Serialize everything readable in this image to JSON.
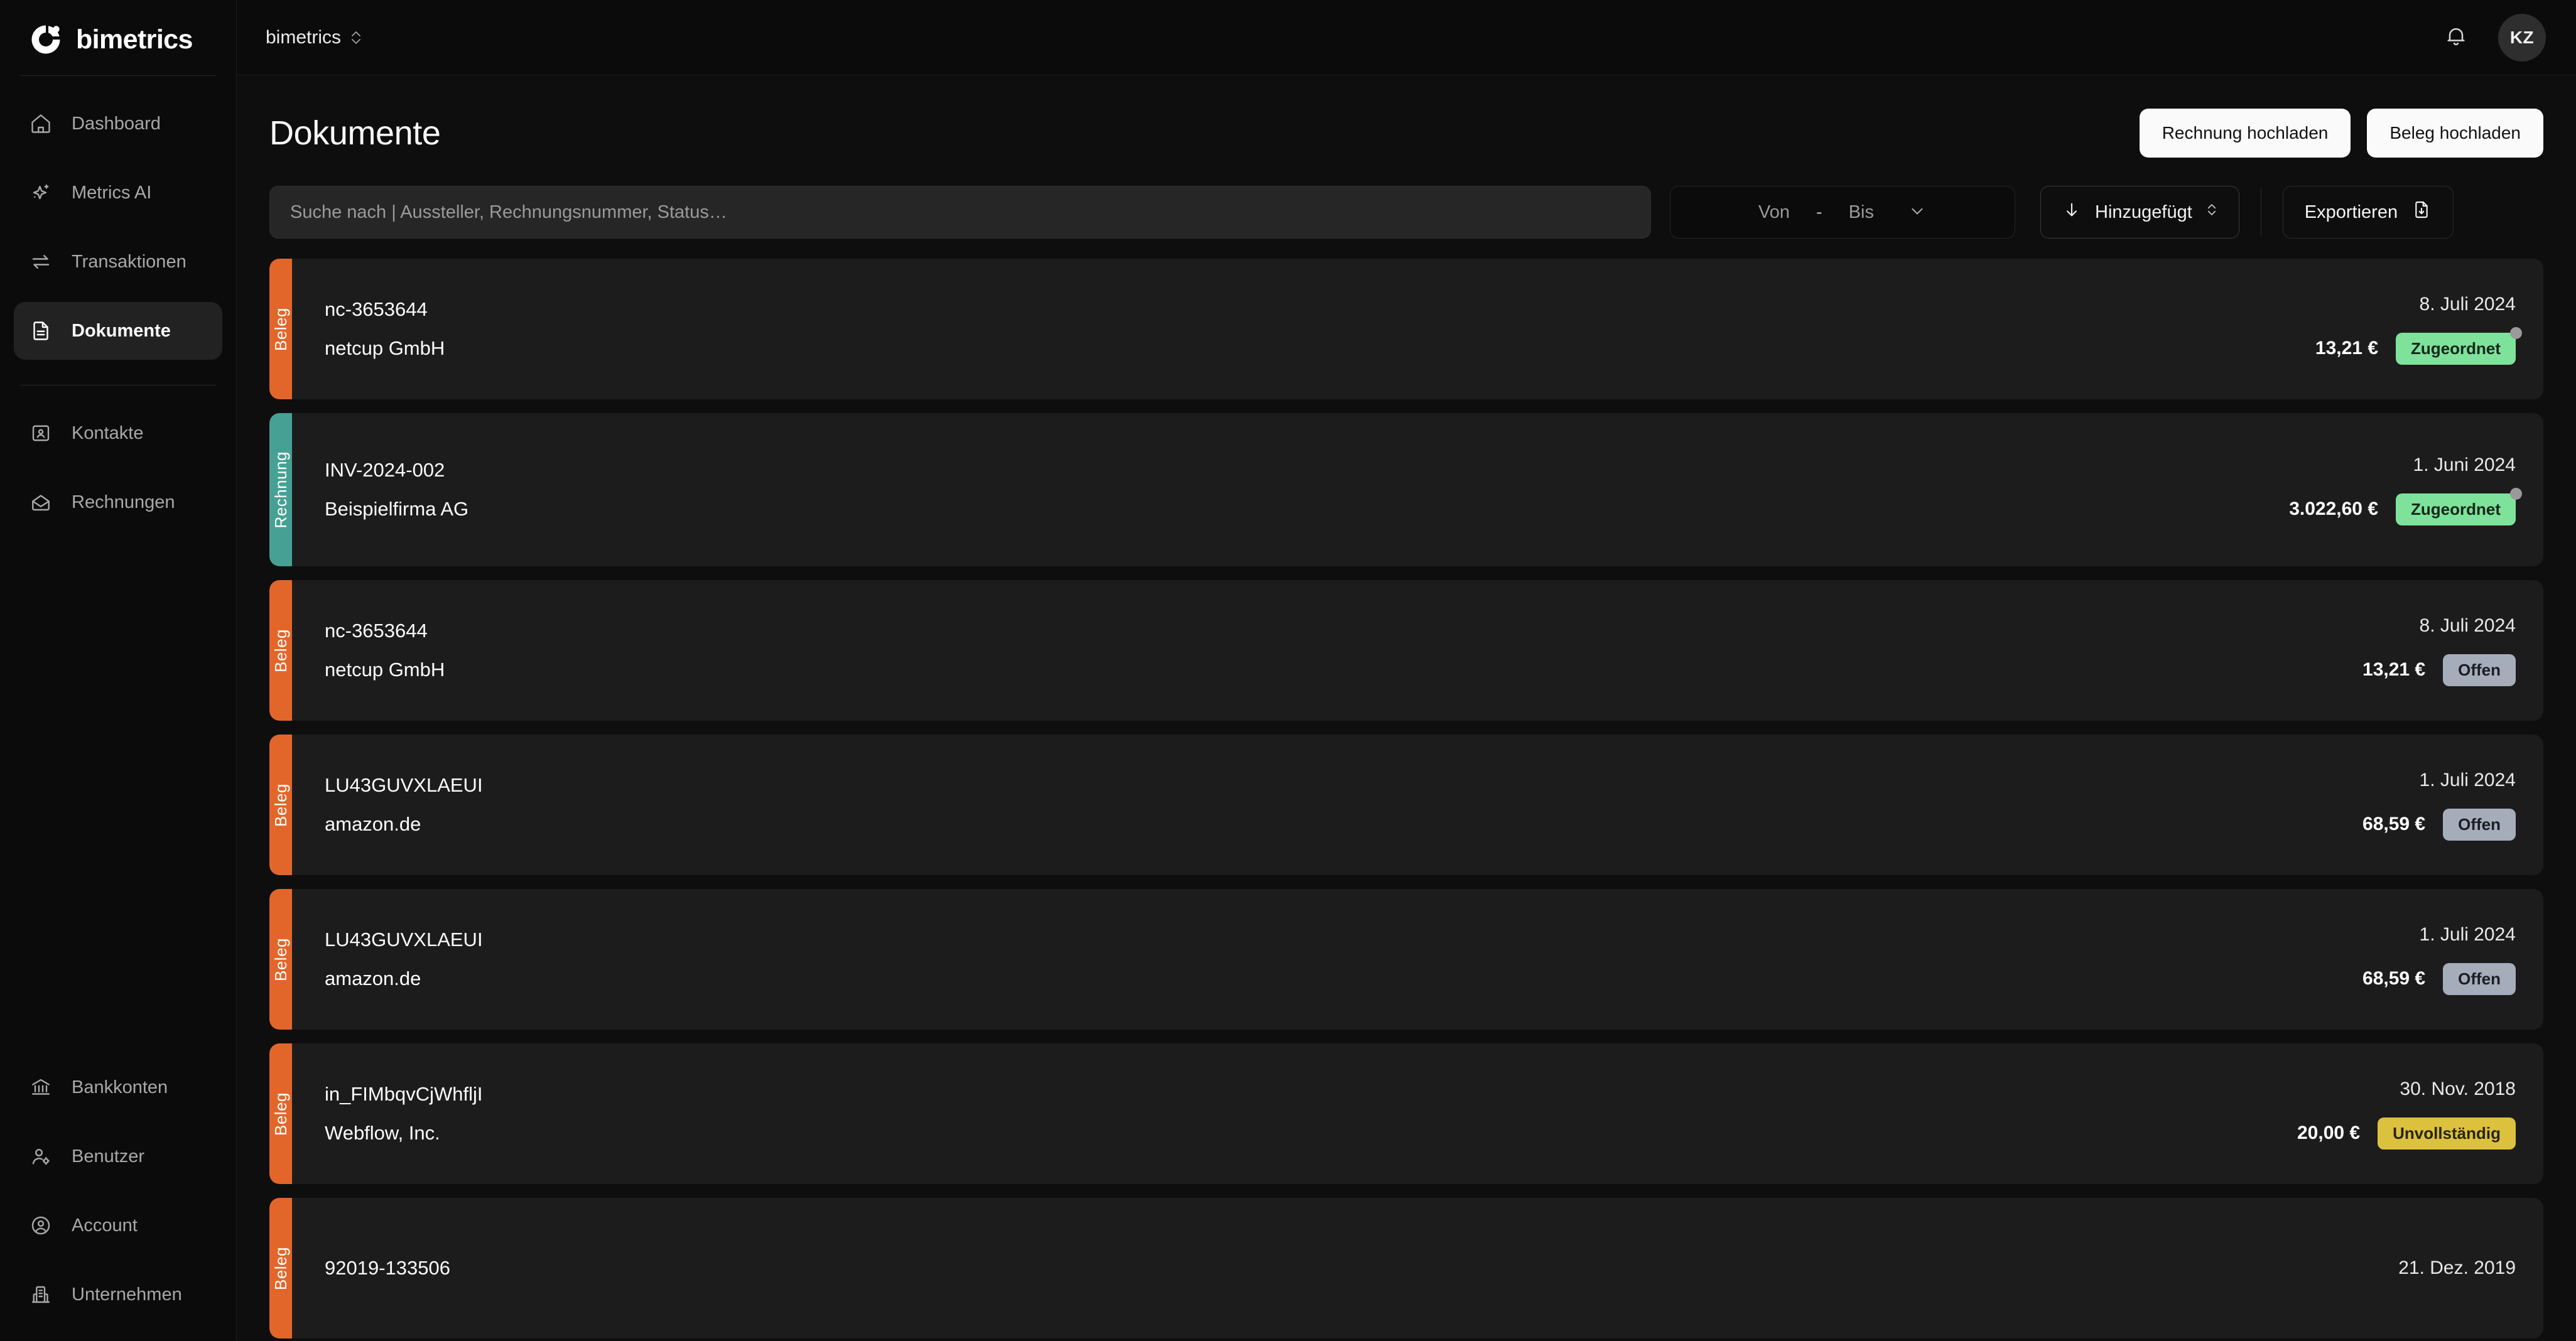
{
  "brand": {
    "name": "bimetrics",
    "logo_icon": "bimetrics-ring-logo"
  },
  "sidebar": {
    "primary_items": [
      {
        "label": "Dashboard",
        "icon": "home-icon",
        "active": false
      },
      {
        "label": "Metrics AI",
        "icon": "sparkles-icon",
        "active": false
      },
      {
        "label": "Transaktionen",
        "icon": "transfer-icon",
        "active": false
      },
      {
        "label": "Dokumente",
        "icon": "document-icon",
        "active": true
      }
    ],
    "secondary_items": [
      {
        "label": "Kontakte",
        "icon": "contact-card-icon",
        "active": false
      },
      {
        "label": "Rechnungen",
        "icon": "envelope-icon",
        "active": false
      }
    ],
    "bottom_items": [
      {
        "label": "Bankkonten",
        "icon": "bank-icon",
        "active": false
      },
      {
        "label": "Benutzer",
        "icon": "user-gear-icon",
        "active": false
      },
      {
        "label": "Account",
        "icon": "user-circle-icon",
        "active": false
      },
      {
        "label": "Unternehmen",
        "icon": "building-icon",
        "active": false
      }
    ]
  },
  "topbar": {
    "workspace": "bimetrics",
    "workspace_chevron_icon": "chevron-up-down-icon",
    "notifications_icon": "bell-icon",
    "avatar_initials": "KZ"
  },
  "page": {
    "title": "Dokumente",
    "actions": [
      {
        "label": "Rechnung hochladen",
        "name": "upload-invoice-button"
      },
      {
        "label": "Beleg hochladen",
        "name": "upload-receipt-button"
      }
    ]
  },
  "filters": {
    "search_placeholder": "Suche nach | Aussteller, Rechnungsnummer, Status…",
    "search_value": "",
    "date_from_label": "Von",
    "date_dash": "-",
    "date_to_label": "Bis",
    "date_chevron_icon": "chevron-down-icon",
    "sort_label": "Hinzugefügt",
    "sort_direction_icon": "arrow-down-icon",
    "sort_chevron_icon": "chevron-up-down-icon",
    "export_label": "Exportieren",
    "export_icon": "document-download-icon"
  },
  "colors": {
    "type_beleg": "#e2662a",
    "type_rechnung": "#46a194",
    "status_zugeordnet": "#7ee29a",
    "status_offen": "#a5adbb",
    "status_unvollstaendig": "#dcc13f",
    "page_background": "#0e0e0e",
    "row_background": "#1c1c1c",
    "sidebar_background": "#0b0b0b"
  },
  "documents": [
    {
      "type": "Beleg",
      "type_class": "type-beleg",
      "number": "nc-3653644",
      "issuer": "netcup GmbH",
      "date": "8. Juli 2024",
      "amount": "13,21 €",
      "status": "Zugeordnet",
      "status_class": "b-green",
      "has_dot": true,
      "tall": false
    },
    {
      "type": "Rechnung",
      "type_class": "type-rechnung",
      "number": "INV-2024-002",
      "issuer": "Beispielfirma AG",
      "date": "1. Juni 2024",
      "amount": "3.022,60 €",
      "status": "Zugeordnet",
      "status_class": "b-green",
      "has_dot": true,
      "tall": true
    },
    {
      "type": "Beleg",
      "type_class": "type-beleg",
      "number": "nc-3653644",
      "issuer": "netcup GmbH",
      "date": "8. Juli 2024",
      "amount": "13,21 €",
      "status": "Offen",
      "status_class": "b-gray",
      "has_dot": false,
      "tall": false
    },
    {
      "type": "Beleg",
      "type_class": "type-beleg",
      "number": "LU43GUVXLAEUI",
      "issuer": "amazon.de",
      "date": "1. Juli 2024",
      "amount": "68,59 €",
      "status": "Offen",
      "status_class": "b-gray",
      "has_dot": false,
      "tall": false
    },
    {
      "type": "Beleg",
      "type_class": "type-beleg",
      "number": "LU43GUVXLAEUI",
      "issuer": "amazon.de",
      "date": "1. Juli 2024",
      "amount": "68,59 €",
      "status": "Offen",
      "status_class": "b-gray",
      "has_dot": false,
      "tall": false
    },
    {
      "type": "Beleg",
      "type_class": "type-beleg",
      "number": "in_FIMbqvCjWhfljI",
      "issuer": "Webflow, Inc.",
      "date": "30. Nov. 2018",
      "amount": "20,00 €",
      "status": "Unvollständig",
      "status_class": "b-yellow",
      "has_dot": false,
      "tall": false
    },
    {
      "type": "Beleg",
      "type_class": "type-beleg",
      "number": "92019-133506",
      "issuer": "",
      "date": "21. Dez. 2019",
      "amount": "",
      "status": "",
      "status_class": "b-yellow",
      "has_dot": false,
      "tall": false
    }
  ]
}
